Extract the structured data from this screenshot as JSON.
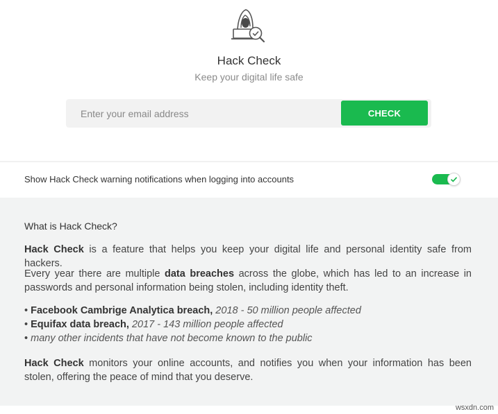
{
  "header": {
    "icon": "hacker-with-check-icon",
    "title": "Hack Check",
    "subtitle": "Keep your digital life safe"
  },
  "email_form": {
    "placeholder": "Enter your email address",
    "value": "",
    "check_label": "CHECK"
  },
  "notification_toggle": {
    "label": "Show Hack Check warning notifications when logging into accounts",
    "enabled": true
  },
  "info": {
    "heading": "What is Hack Check?",
    "p1_bold": "Hack Check",
    "p1_rest": " is a feature that helps you keep your digital life and personal identity safe from hackers.",
    "p2_before": "Every year there are multiple ",
    "p2_bold": "data breaches",
    "p2_after": " across the globe, which has led to an increase in passwords and personal information being stolen, including identity theft.",
    "bullets": [
      {
        "bullet": "• ",
        "bold": "Facebook Cambrige Analytica breach,",
        "italic": " 2018 - 50 million people affected"
      },
      {
        "bullet": "• ",
        "bold": "Equifax data breach,",
        "italic": " 2017 - 143 million people affected"
      },
      {
        "bullet": "• ",
        "bold": "",
        "italic": "many other incidents that have not become known to the public"
      }
    ],
    "p4_bold": "Hack Check",
    "p4_rest": " monitors your online accounts, and notifies you when your information has been stolen, offering the peace of mind that you deserve."
  },
  "watermark": "wsxdn.com",
  "colors": {
    "accent_green": "#1aba4f",
    "panel_bg": "#f2f3f3",
    "input_bg": "#f2f2f2"
  }
}
